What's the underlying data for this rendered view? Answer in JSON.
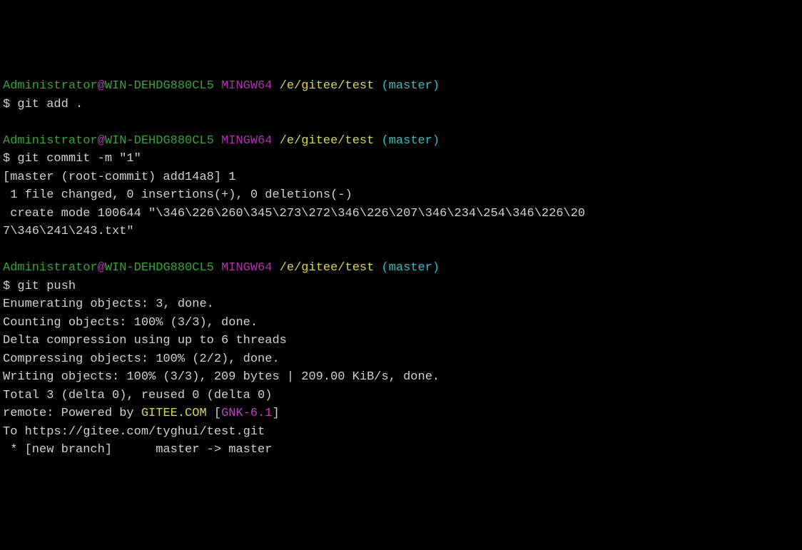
{
  "prompt": {
    "user": "Administrator",
    "at": "@",
    "host": "WIN-DEHDG880CL5",
    "env": "MINGW64",
    "path": "/e/gitee/test",
    "branch": "(master)"
  },
  "blocks": [
    {
      "dollar": "$ ",
      "command": "git add .",
      "output": []
    },
    {
      "dollar": "$ ",
      "command": "git commit -m \"1\"",
      "output": [
        {
          "text": "[master (root-commit) add14a8] 1"
        },
        {
          "text": " 1 file changed, 0 insertions(+), 0 deletions(-)"
        },
        {
          "text": " create mode 100644 \"\\346\\226\\260\\345\\273\\272\\346\\226\\207\\346\\234\\254\\346\\226\\20"
        },
        {
          "text": "7\\346\\241\\243.txt\""
        }
      ]
    },
    {
      "dollar": "$ ",
      "command": "git push",
      "output": [
        {
          "text": "Enumerating objects: 3, done."
        },
        {
          "text": "Counting objects: 100% (3/3), done."
        },
        {
          "text": "Delta compression using up to 6 threads"
        },
        {
          "text": "Compressing objects: 100% (2/2), done."
        },
        {
          "text": "Writing objects: 100% (3/3), 209 bytes | 209.00 KiB/s, done."
        },
        {
          "text": "Total 3 (delta 0), reused 0 (delta 0)"
        },
        {
          "pre": "remote: Powered by ",
          "gitee": "GITEE.COM",
          "mid": " [",
          "gnk": "GNK-6.1",
          "post": "]"
        },
        {
          "text": "To https://gitee.com/tyghui/test.git"
        },
        {
          "text": " * [new branch]      master -> master"
        }
      ]
    }
  ]
}
